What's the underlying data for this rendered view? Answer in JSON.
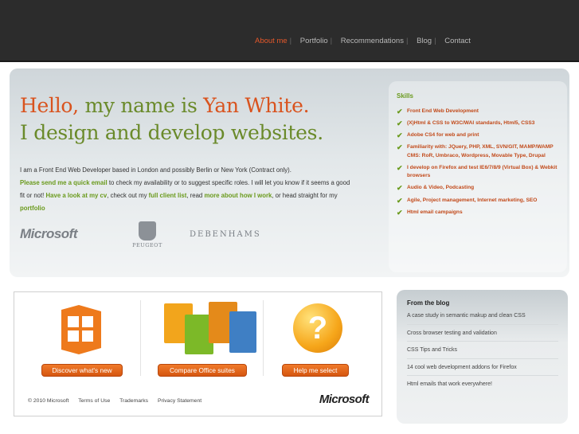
{
  "nav": {
    "items": [
      {
        "label": "About me",
        "active": true
      },
      {
        "label": "Portfolio",
        "active": false
      },
      {
        "label": "Recommendations",
        "active": false
      },
      {
        "label": "Blog",
        "active": false
      },
      {
        "label": "Contact",
        "active": false
      }
    ],
    "separator": "|"
  },
  "hero": {
    "line1_part1": "Hello,",
    "line1_part2": " my name is ",
    "line1_part3": "Yan White.",
    "line2_part1": "I ",
    "line2_part2": "design",
    "line2_part3": " and ",
    "line2_part4": "develop",
    "line2_part5": " websites.",
    "intro_1": "I am a Front End Web Developer based in London and possibly Berlin or New York (Contract only).",
    "link_email": "Please send me a quick email",
    "intro_2": " to check my availability or to suggest specific roles. I will let you know if it seems a good fit or not! ",
    "link_cv": "Have a look at my cv",
    "intro_3": ", check out my ",
    "link_clients": "full client list",
    "intro_4": ", read ",
    "link_more": "more about how I work",
    "intro_5": ", or head straight for my ",
    "link_portfolio": "portfolio",
    "logos": {
      "microsoft": "Microsoft",
      "peugeot": "PEUGEOT",
      "debenhams": "DEBENHAMS"
    }
  },
  "skills": {
    "title": "Skills",
    "items": [
      {
        "text": "Front End Web Development"
      },
      {
        "text": "(X)Html & CSS to W3C/WAI standards, Html5, CSS3"
      },
      {
        "text": "Adobe CS4 for web and print"
      },
      {
        "text": "Familiarity with: JQuery, PHP, XML, SVN/GIT, MAMP/WAMP",
        "sub": "CMS: RoR, Umbraco, Wordpress, Movable Type, Drupal"
      },
      {
        "text": "I develop on Firefox and test IE6/7/8/9 (Virtual Box) & Webkit browsers"
      },
      {
        "text": "Audio & Video, Podcasting"
      },
      {
        "text": "Agile, Project management, Internet marketing, SEO"
      },
      {
        "text": "Html email campaigns"
      }
    ],
    "check_icon": "check-icon",
    "colors": {
      "accent": "#6a9a1c",
      "skill_text": "#c24a1a"
    }
  },
  "ad": {
    "buttons": [
      "Discover what's new",
      "Compare Office suites",
      "Help me select"
    ],
    "question_mark": "?",
    "footer_links": [
      "© 2010 Microsoft",
      "Terms of Use",
      "Trademarks",
      "Privacy Statement"
    ],
    "footer_logo": "Microsoft"
  },
  "blog": {
    "title": "From the blog",
    "posts": [
      "A case study in semantic makup and clean CSS",
      "Cross browser testing and validation",
      "CSS Tips and Tricks",
      "14 cool web development addons for Firefox",
      "Html emails that work everywhere!"
    ]
  },
  "colors": {
    "topbar": "#2c2c2c",
    "nav_active": "#e5582a",
    "heading_orange": "#d9531e",
    "heading_green": "#6a8a2a"
  }
}
